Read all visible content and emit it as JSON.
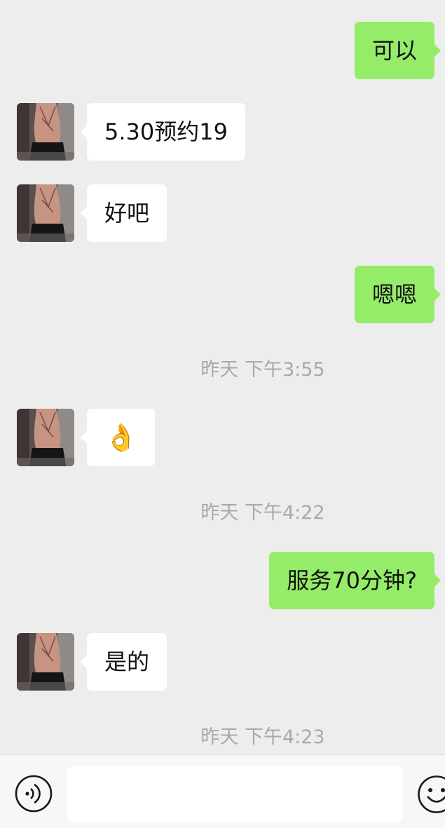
{
  "conversation": {
    "messages": [
      {
        "type": "message",
        "direction": "out",
        "text": "可以"
      },
      {
        "type": "message",
        "direction": "in",
        "text": "5.30预约19"
      },
      {
        "type": "message",
        "direction": "in",
        "text": "好吧"
      },
      {
        "type": "message",
        "direction": "out",
        "text": "嗯嗯"
      },
      {
        "type": "timestamp",
        "text": "昨天 下午3:55"
      },
      {
        "type": "message",
        "direction": "in",
        "text": "👌",
        "emoji": true
      },
      {
        "type": "timestamp",
        "text": "昨天 下午4:22"
      },
      {
        "type": "message",
        "direction": "out",
        "text": "服务70分钟?"
      },
      {
        "type": "message",
        "direction": "in",
        "text": "是的"
      },
      {
        "type": "timestamp",
        "text": "昨天 下午4:23"
      }
    ]
  },
  "input_bar": {
    "voice_icon": "voice-icon",
    "input_value": "",
    "emoji_icon": "smiley-face-icon"
  },
  "colors": {
    "background": "#ededed",
    "outgoing_bubble": "#95ec69",
    "incoming_bubble": "#ffffff",
    "timestamp_text": "#a9a9a9"
  }
}
